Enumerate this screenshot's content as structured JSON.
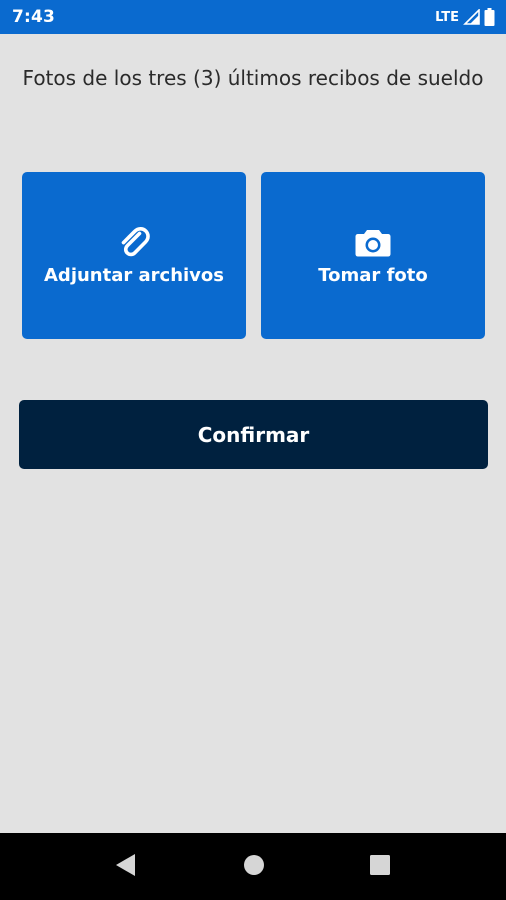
{
  "status_bar": {
    "time": "7:43",
    "network": "LTE",
    "signal_icon": "signal-icon",
    "battery_icon": "battery-icon"
  },
  "heading": {
    "text": "Fotos de los tres (3) últimos recibos de sueldo"
  },
  "actions": {
    "attach": {
      "label": "Adjuntar archivos",
      "icon": "paperclip-icon"
    },
    "photo": {
      "label": "Tomar foto",
      "icon": "camera-icon"
    }
  },
  "confirm": {
    "label": "Confirmar"
  },
  "nav": {
    "back_icon": "back-icon",
    "home_icon": "home-icon",
    "recents_icon": "recents-icon"
  },
  "colors": {
    "accent": "#0a6acf",
    "primary_dark": "#00213f",
    "background": "#e2e2e2"
  }
}
